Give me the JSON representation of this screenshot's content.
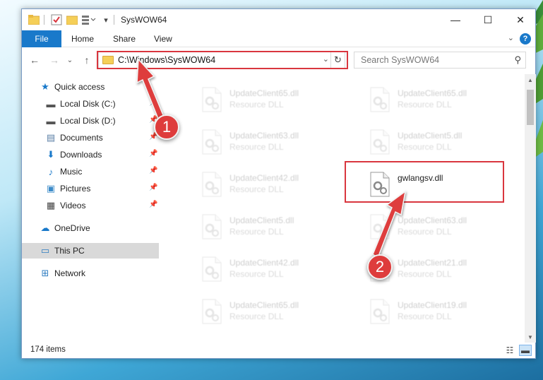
{
  "window": {
    "title": "SysWOW64",
    "minimize": "—",
    "maximize": "☐",
    "close": "✕"
  },
  "ribbon": {
    "tabs": [
      "File",
      "Home",
      "Share",
      "View"
    ],
    "collapse_glyph": "⌄",
    "help_glyph": "?"
  },
  "nav": {
    "back_glyph": "←",
    "forward_glyph": "→",
    "recent_glyph": "⌄",
    "up_glyph": "↑",
    "address": "C:\\Windows\\SysWOW64",
    "address_dropdown_glyph": "⌄",
    "refresh_glyph": "↻",
    "search_placeholder": "Search SysWOW64",
    "search_glyph": "⚲"
  },
  "sidebar": {
    "items": [
      {
        "label": "Quick access",
        "icon": "star-icon",
        "glyph": "★",
        "color": "#1979ca",
        "pinned": false
      },
      {
        "label": "Local Disk (C:)",
        "icon": "drive-icon",
        "glyph": "▬",
        "color": "#555555",
        "pinned": true
      },
      {
        "label": "Local Disk (D:)",
        "icon": "drive-icon",
        "glyph": "▬",
        "color": "#555555",
        "pinned": true
      },
      {
        "label": "Documents",
        "icon": "documents-icon",
        "glyph": "▤",
        "color": "#5b7fa6",
        "pinned": true
      },
      {
        "label": "Downloads",
        "icon": "download-icon",
        "glyph": "⬇",
        "color": "#1979ca",
        "pinned": true
      },
      {
        "label": "Music",
        "icon": "music-icon",
        "glyph": "♪",
        "color": "#1979ca",
        "pinned": true
      },
      {
        "label": "Pictures",
        "icon": "pictures-icon",
        "glyph": "▣",
        "color": "#3c8bc9",
        "pinned": true
      },
      {
        "label": "Videos",
        "icon": "videos-icon",
        "glyph": "▦",
        "color": "#444444",
        "pinned": true
      },
      {
        "label": "OneDrive",
        "icon": "cloud-icon",
        "glyph": "☁",
        "color": "#1979ca",
        "pinned": false
      },
      {
        "label": "This PC",
        "icon": "computer-icon",
        "glyph": "▭",
        "color": "#2f7dc1",
        "pinned": false
      },
      {
        "label": "Network",
        "icon": "network-icon",
        "glyph": "⊞",
        "color": "#2f7dc1",
        "pinned": false
      }
    ],
    "pin_glyph": "📌"
  },
  "files": [
    {
      "name": "UpdateClient65.dll",
      "type": "Resource DLL",
      "highlighted": false
    },
    {
      "name": "UpdateClient65.dll",
      "type": "Resource DLL",
      "highlighted": false
    },
    {
      "name": "UpdateClient63.dll",
      "type": "Resource DLL",
      "highlighted": false
    },
    {
      "name": "UpdateClient5.dll",
      "type": "Resource DLL",
      "highlighted": false
    },
    {
      "name": "UpdateClient42.dll",
      "type": "Resource DLL",
      "highlighted": false
    },
    {
      "name": "gwlangsv.dll",
      "type": "",
      "highlighted": true
    },
    {
      "name": "UpdateClient5.dll",
      "type": "Resource DLL",
      "highlighted": false
    },
    {
      "name": "UpdateClient63.dll",
      "type": "Resource DLL",
      "highlighted": false
    },
    {
      "name": "UpdateClient42.dll",
      "type": "Resource DLL",
      "highlighted": false
    },
    {
      "name": "UpdateClient21.dll",
      "type": "Resource DLL",
      "highlighted": false
    },
    {
      "name": "UpdateClient65.dll",
      "type": "Resource DLL",
      "highlighted": false
    },
    {
      "name": "UpdateClient19.dll",
      "type": "Resource DLL",
      "highlighted": false
    }
  ],
  "status": {
    "item_count": "174 items",
    "details_view_glyph": "☷",
    "icons_view_glyph": "▬"
  },
  "callouts": [
    {
      "label": "1"
    },
    {
      "label": "2"
    }
  ],
  "colors": {
    "accent": "#1979ca",
    "highlight_red": "#d9363e",
    "callout_red": "#de3c3c"
  }
}
